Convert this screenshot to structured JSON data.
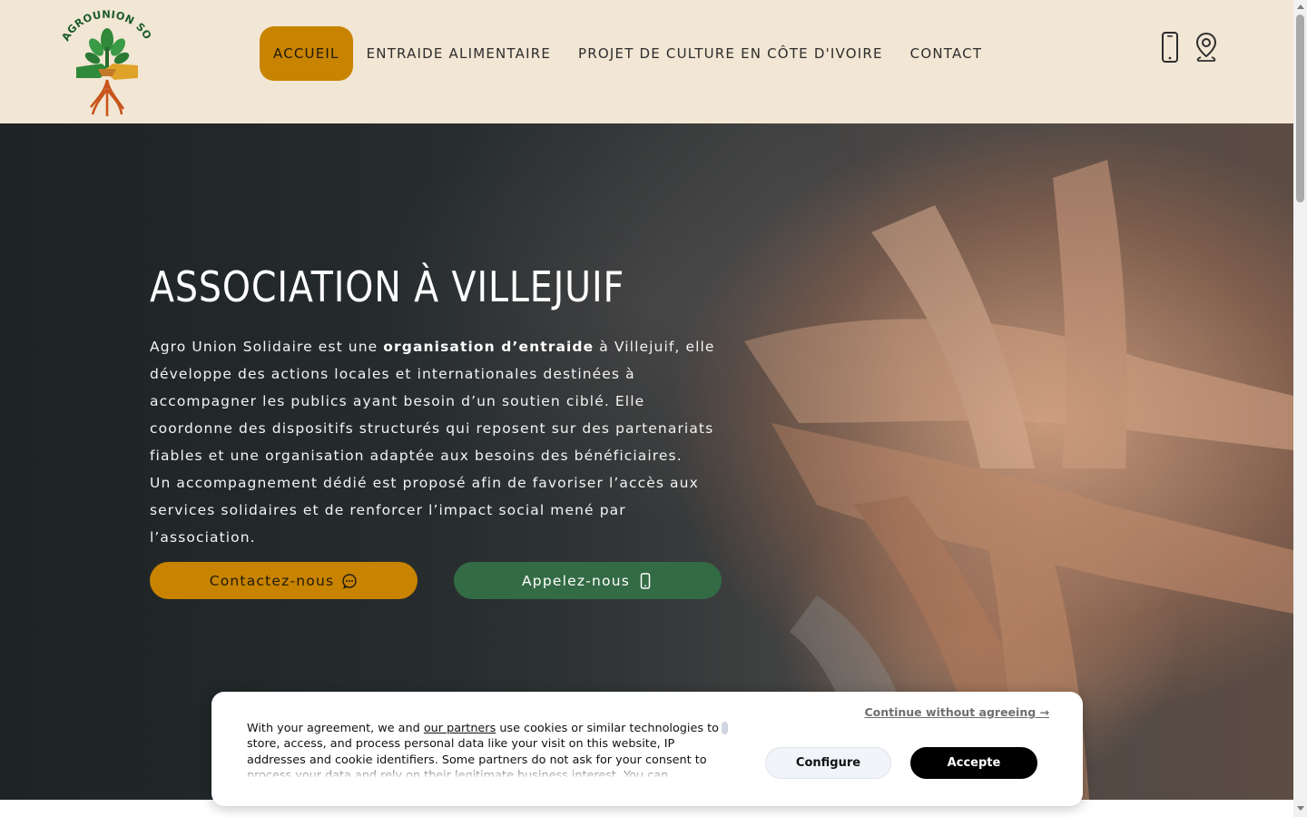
{
  "header": {
    "logo": {
      "text": "AGROUNION SOLIDAIRE",
      "icon": "plant-handshake-logo"
    },
    "nav": [
      {
        "label": "ACCUEIL",
        "active": true
      },
      {
        "label": "ENTRAIDE ALIMENTAIRE",
        "active": false
      },
      {
        "label": "PROJET DE CULTURE EN CÔTE D'IVOIRE",
        "active": false
      },
      {
        "label": "CONTACT",
        "active": false
      }
    ],
    "icons": [
      "phone-icon",
      "location-pin-icon"
    ]
  },
  "hero": {
    "title": "ASSOCIATION À VILLEJUIF",
    "paragraph_1": {
      "before": "Agro Union Solidaire est une ",
      "bold": "organisation d’entraide",
      "after": " à Villejuif, elle développe des actions locales et internationales destinées à accompagner les publics ayant besoin d’un soutien ciblé. Elle coordonne des dispositifs structurés qui reposent sur des partenariats fiables et une organisation adaptée aux besoins des bénéficiaires."
    },
    "paragraph_2": "Un accompagnement dédié est proposé afin de favoriser l’accès aux services solidaires et de renforcer l’impact social mené par l’association.",
    "buttons": {
      "contact": {
        "label": "Contactez-nous",
        "icon": "chat-bubble-icon"
      },
      "call": {
        "label": "Appelez-nous",
        "icon": "phone-icon"
      }
    },
    "background_image": "stacked-hands-photo"
  },
  "cookie_banner": {
    "text_before": "With your agreement, we and ",
    "partners_link": "our partners",
    "text_after": " use cookies or similar technologies to store, access, and process personal data like your visit on this website, IP addresses and cookie identifiers. Some partners do not ask for your consent to process your data and rely on their legitimate business interest. You can",
    "continue_link": "Continue without agreeing →",
    "configure_label": "Configure",
    "accept_label": "Accepte"
  },
  "colors": {
    "header_bg": "#f2e6d4",
    "accent_orange": "#c88300",
    "accent_green": "#336b45",
    "text_dark": "#2d2d2d"
  }
}
